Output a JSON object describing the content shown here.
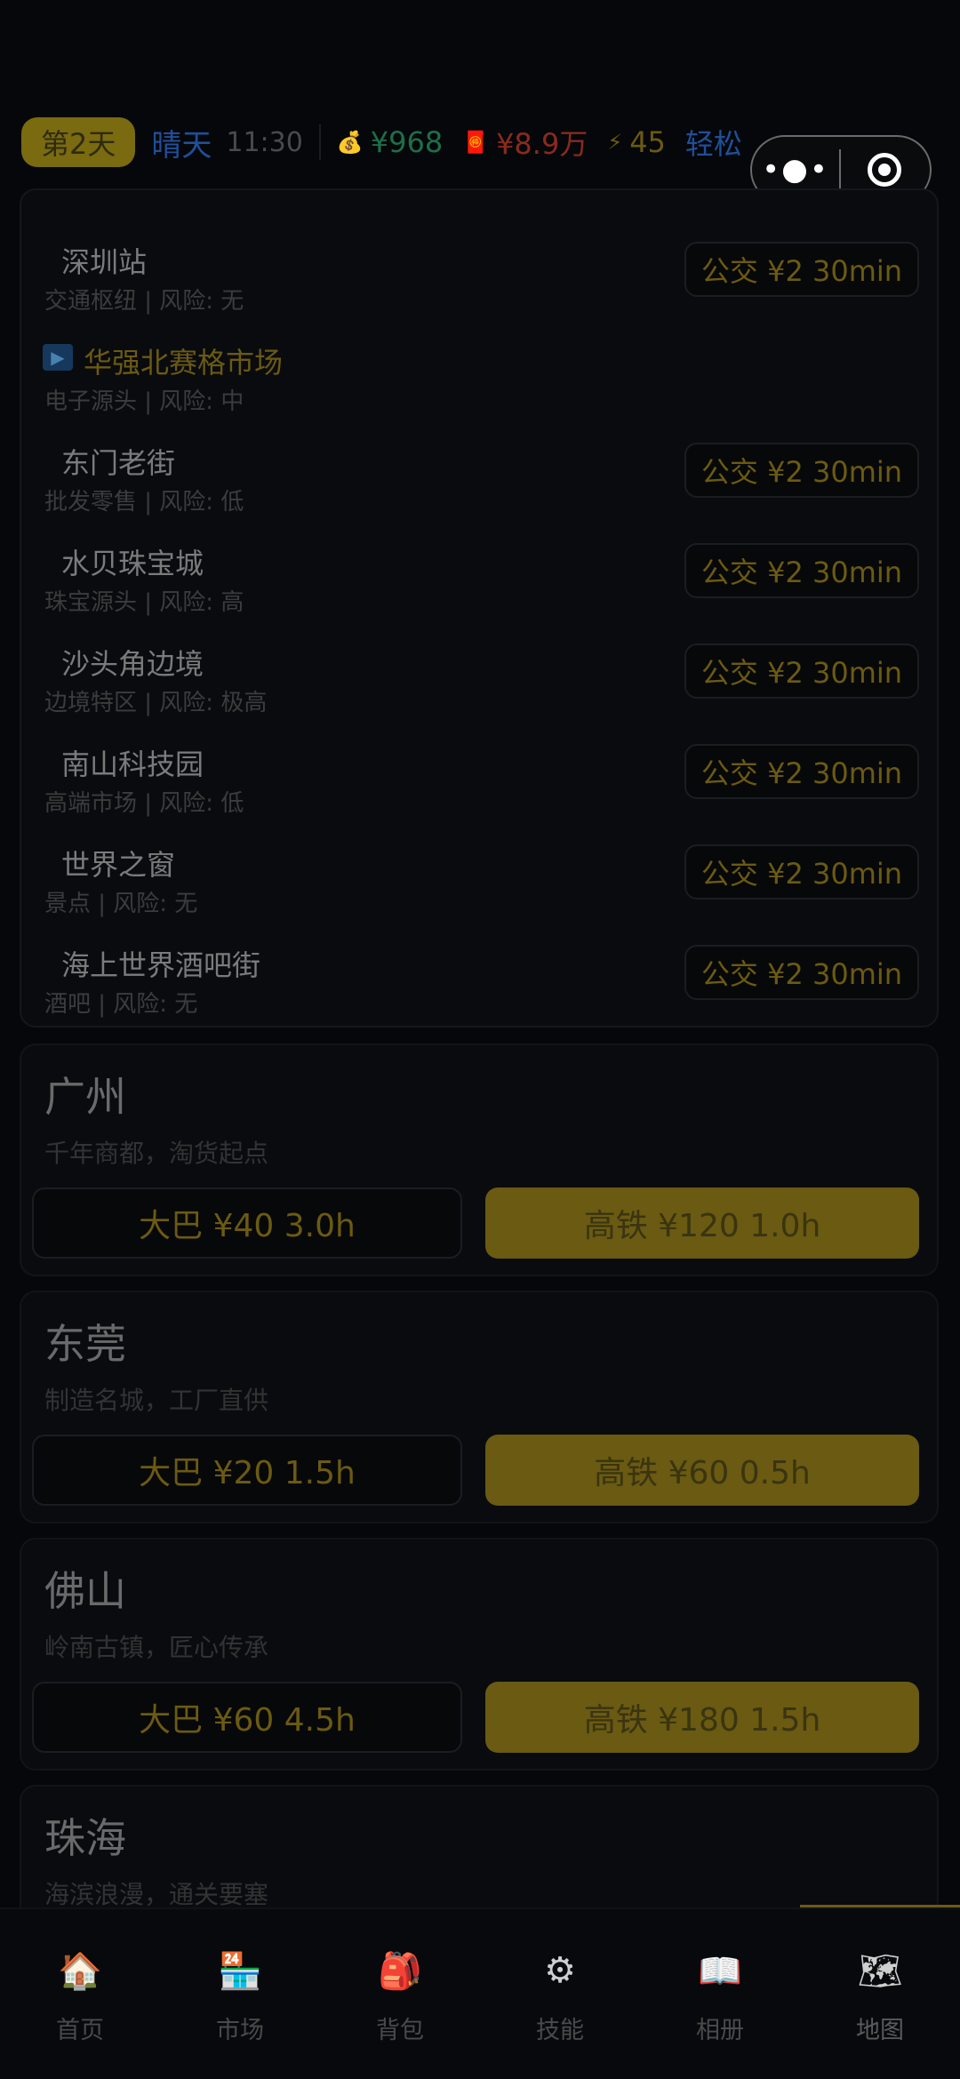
{
  "status": {
    "day": "第2天",
    "weather": "晴天",
    "time": "11:30",
    "cash": "¥968",
    "debt": "¥8.9万",
    "energy": "45",
    "mood": "轻松"
  },
  "current_city_stations": [
    {
      "name": "深圳站",
      "desc": "交通枢纽 | 风险: 无",
      "action": "公交 ¥2 30min",
      "current": false
    },
    {
      "name": "华强北赛格市场",
      "desc": "电子源头 | 风险: 中",
      "action": "",
      "current": true
    },
    {
      "name": "东门老街",
      "desc": "批发零售 | 风险: 低",
      "action": "公交 ¥2 30min",
      "current": false
    },
    {
      "name": "水贝珠宝城",
      "desc": "珠宝源头 | 风险: 高",
      "action": "公交 ¥2 30min",
      "current": false
    },
    {
      "name": "沙头角边境",
      "desc": "边境特区 | 风险: 极高",
      "action": "公交 ¥2 30min",
      "current": false
    },
    {
      "name": "南山科技园",
      "desc": "高端市场 | 风险: 低",
      "action": "公交 ¥2 30min",
      "current": false
    },
    {
      "name": "世界之窗",
      "desc": "景点 | 风险: 无",
      "action": "公交 ¥2 30min",
      "current": false
    },
    {
      "name": "海上世界酒吧街",
      "desc": "酒吧 | 风险: 无",
      "action": "公交 ¥2 30min",
      "current": false
    }
  ],
  "cities": [
    {
      "name": "广州",
      "desc": "千年商都，淘货起点",
      "bus": "大巴 ¥40 3.0h",
      "rail": "高铁 ¥120 1.0h"
    },
    {
      "name": "东莞",
      "desc": "制造名城，工厂直供",
      "bus": "大巴 ¥20 1.5h",
      "rail": "高铁 ¥60 0.5h"
    },
    {
      "name": "佛山",
      "desc": "岭南古镇，匠心传承",
      "bus": "大巴 ¥60 4.5h",
      "rail": "高铁 ¥180 1.5h"
    },
    {
      "name": "珠海",
      "desc": "海滨浪漫，通关要塞"
    }
  ],
  "tabs": [
    {
      "label": "首页",
      "icon": "house-icon"
    },
    {
      "label": "市场",
      "icon": "market-stall-icon"
    },
    {
      "label": "背包",
      "icon": "backpack-icon"
    },
    {
      "label": "技能",
      "icon": "gear-skill-icon"
    },
    {
      "label": "相册",
      "icon": "photo-album-icon"
    },
    {
      "label": "地图",
      "icon": "map-icon"
    }
  ],
  "active_tab": "地图"
}
